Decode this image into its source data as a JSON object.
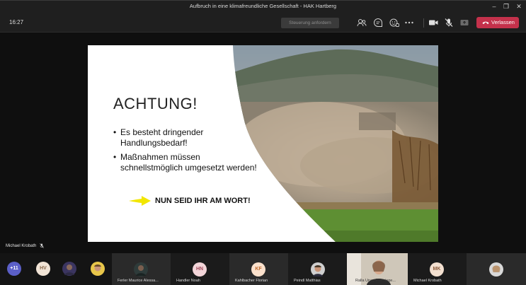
{
  "window": {
    "title": "Aufbruch in eine klimafreundliche Gesellschaft - HAK Hartberg"
  },
  "toolbar": {
    "time": "16:27",
    "take_control_label": "Steuerung anfordern",
    "leave_label": "Verlassen",
    "leave_color": "#c4314b"
  },
  "slide": {
    "title": "ACHTUNG!",
    "bullets": [
      "Es besteht dringender Handlungsbedarf!",
      "Maßnahmen müssen schnellstmöglich umgesetzt werden!"
    ],
    "callout": "NUN SEID IHR AM WORT!",
    "arrow_color": "#f2e600"
  },
  "presenter": {
    "name": "Michael Krobath"
  },
  "participants": {
    "overflow_count": "+11",
    "initials": [
      "HV",
      "HN",
      "KF",
      "MK"
    ],
    "names": [
      "Ferler Maurice Alessa...",
      "Handler Noah",
      "Kahlbacher Florian",
      "Peindl Matthias",
      "Ralla Unay-Premiege...",
      "Michael Krobath"
    ]
  }
}
